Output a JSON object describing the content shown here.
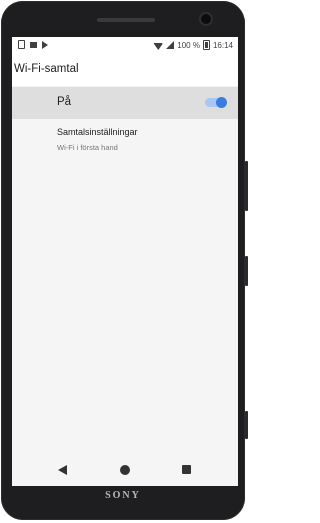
{
  "status_bar": {
    "battery_text": "100 %",
    "time": "16:14",
    "icons": [
      "sim-icon",
      "image-icon",
      "play-store-icon",
      "wifi-icon",
      "signal-icon",
      "battery-icon"
    ]
  },
  "app_bar": {
    "title": "Wi-Fi-samtal"
  },
  "switch_row": {
    "label": "På",
    "toggle_on": true
  },
  "settings_row": {
    "title": "Samtalsinställningar",
    "subtitle": "Wi-Fi i första hand"
  },
  "nav_bar": {
    "icons": [
      "back-icon",
      "home-icon",
      "recents-icon"
    ]
  },
  "device": {
    "brand": "SONY"
  },
  "colors": {
    "accent": "#3a7ce0",
    "accent_track": "#a9c7f2",
    "row_highlight": "#dedede"
  }
}
